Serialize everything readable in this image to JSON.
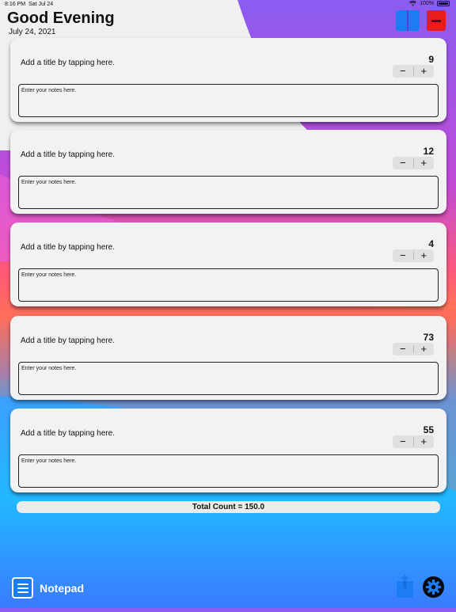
{
  "status": {
    "time": "8:16 PM",
    "date": "Sat Jul 24",
    "battery": "100%"
  },
  "header": {
    "greeting": "Good Evening",
    "date": "July 24, 2021"
  },
  "cards": [
    {
      "title": "Add a title by tapping here.",
      "count": "9",
      "notes_placeholder": "Enter your notes here."
    },
    {
      "title": "Add a title by tapping here.",
      "count": "12",
      "notes_placeholder": "Enter your notes here."
    },
    {
      "title": "Add a title by tapping here.",
      "count": "4",
      "notes_placeholder": "Enter your notes here."
    },
    {
      "title": "Add a title by tapping here.",
      "count": "73",
      "notes_placeholder": "Enter your notes here."
    },
    {
      "title": "Add a title by tapping here.",
      "count": "55",
      "notes_placeholder": "Enter your notes here."
    }
  ],
  "stepper": {
    "minus": "−",
    "plus": "+"
  },
  "total": "Total Count = 150.0",
  "footer": {
    "app_name": "Notepad",
    "icons": [
      "notepad-icon",
      "share-icon",
      "gear-icon"
    ]
  },
  "colors": {
    "accent": "#1c7cf2",
    "danger": "#ea1b1b",
    "card_bg": "#f2f2f2"
  }
}
